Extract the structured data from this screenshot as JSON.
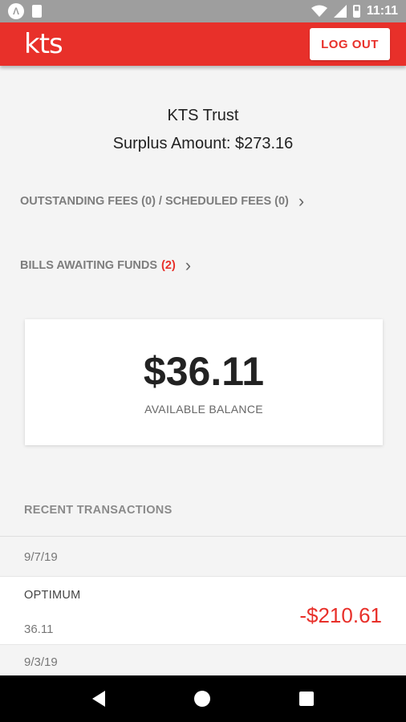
{
  "status_bar": {
    "time": "11:11",
    "icons": [
      "notification-a-icon",
      "sd-card-icon",
      "wifi-icon",
      "signal-icon",
      "battery-icon"
    ],
    "notif_glyph": "Λ"
  },
  "app_bar": {
    "logo_text": "kts",
    "logout_label": "LOG OUT",
    "accent_color": "#e8302a"
  },
  "summary": {
    "trust_name": "KTS Trust",
    "surplus_text": "Surplus Amount: $273.16"
  },
  "links": {
    "fees_label": "OUTSTANDING FEES (0) / SCHEDULED FEES (0)",
    "bills_label": "BILLS AWAITING FUNDS",
    "bills_count": "(2)",
    "chevron": "›"
  },
  "balance": {
    "amount": "$36.11",
    "label": "AVAILABLE BALANCE"
  },
  "transactions": {
    "header": "RECENT TRANSACTIONS",
    "groups": [
      {
        "date": "9/7/19",
        "items": [
          {
            "name": "OPTIMUM",
            "sub": "36.11",
            "amount": "-$210.61"
          }
        ]
      },
      {
        "date": "9/3/19",
        "items": []
      }
    ]
  },
  "nav_bar": {
    "icons": [
      "back-icon",
      "home-icon",
      "recents-icon"
    ]
  }
}
